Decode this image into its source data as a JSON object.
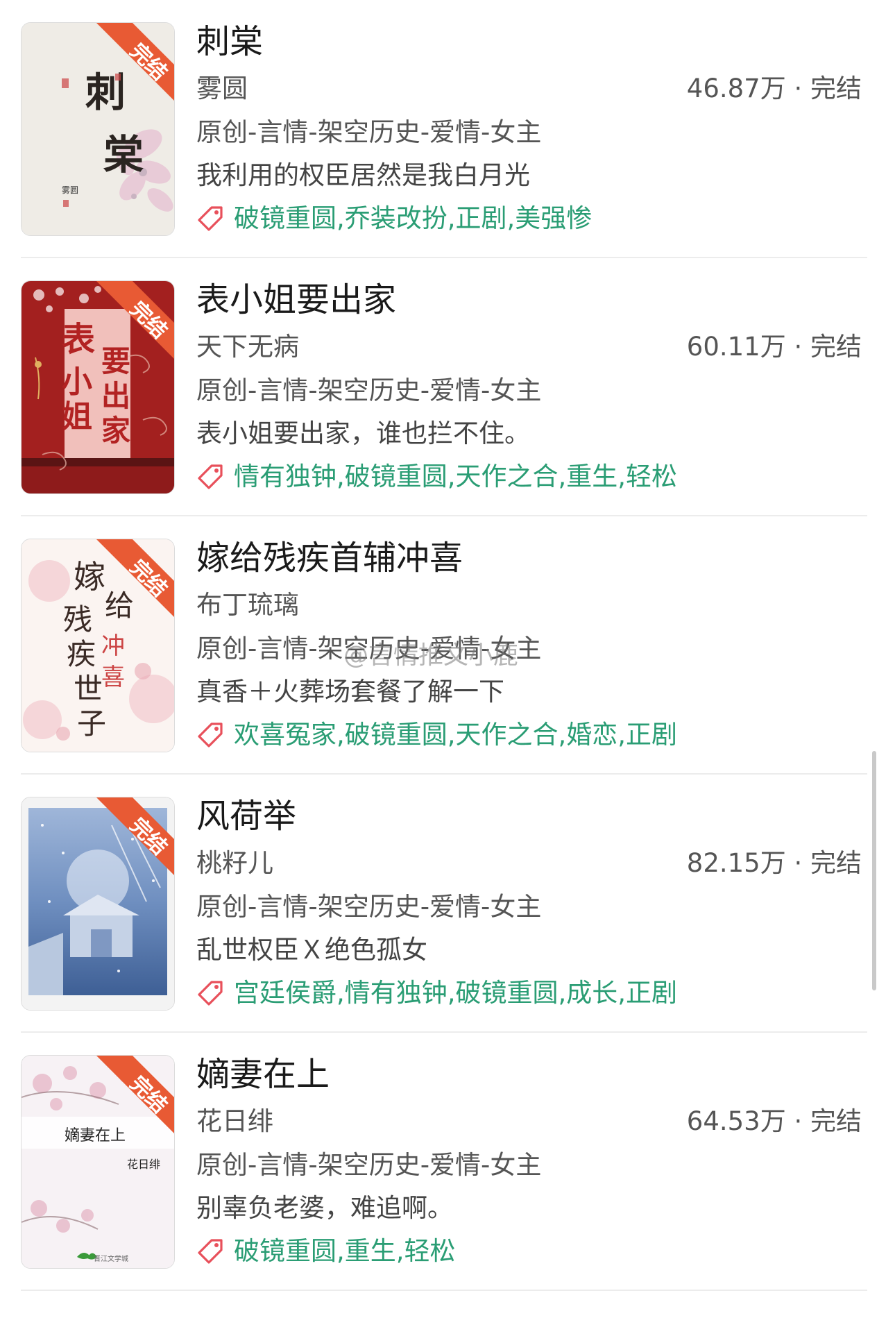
{
  "colors": {
    "accent_green": "#2a9d74",
    "ribbon_orange": "#e85a34",
    "tag_icon_red": "#e8505b",
    "text_primary": "#1a1a1a",
    "text_secondary": "#555555"
  },
  "watermark": "@言情推文小鹿",
  "books": [
    {
      "title": "刺棠",
      "author": "雾圆",
      "stats": "46.87万 · 完结",
      "category": "原创-言情-架空历史-爱情-女主",
      "intro": "我利用的权臣居然是我白月光",
      "tags": "破镜重圆,乔装改扮,正剧,美强惨",
      "ribbon": "完结",
      "cover_text": "刺棠",
      "cover_author": "雾圆",
      "tag_icon": "price-tag-icon"
    },
    {
      "title": "表小姐要出家",
      "author": "天下无病",
      "stats": "60.11万 · 完结",
      "category": "原创-言情-架空历史-爱情-女主",
      "intro": "表小姐要出家，谁也拦不住。",
      "tags": "情有独钟,破镜重圆,天作之合,重生,轻松",
      "ribbon": "完结",
      "cover_text": "表小姐要出家",
      "tag_icon": "price-tag-icon"
    },
    {
      "title": "嫁给残疾首辅冲喜",
      "author": "布丁琉璃",
      "stats": "",
      "category": "原创-言情-架空历史-爱情-女主",
      "intro": "真香＋火葬场套餐了解一下",
      "tags": "欢喜冤家,破镜重圆,天作之合,婚恋,正剧",
      "ribbon": "完结",
      "cover_text": "嫁给残疾世子冲喜",
      "tag_icon": "price-tag-icon"
    },
    {
      "title": "风荷举",
      "author": "桃籽儿",
      "stats": "82.15万 · 完结",
      "category": "原创-言情-架空历史-爱情-女主",
      "intro": "乱世权臣Ｘ绝色孤女",
      "tags": "宫廷侯爵,情有独钟,破镜重圆,成长,正剧",
      "ribbon": "完结",
      "tag_icon": "price-tag-icon"
    },
    {
      "title": "嫡妻在上",
      "author": "花日绯",
      "stats": "64.53万 · 完结",
      "category": "原创-言情-架空历史-爱情-女主",
      "intro": "别辜负老婆，难追啊。",
      "tags": "破镜重圆,重生,轻松",
      "ribbon": "完结",
      "cover_text": "嫡妻在上",
      "cover_author": "花日绯",
      "cover_publisher": "晋江文学城",
      "tag_icon": "price-tag-icon"
    }
  ]
}
